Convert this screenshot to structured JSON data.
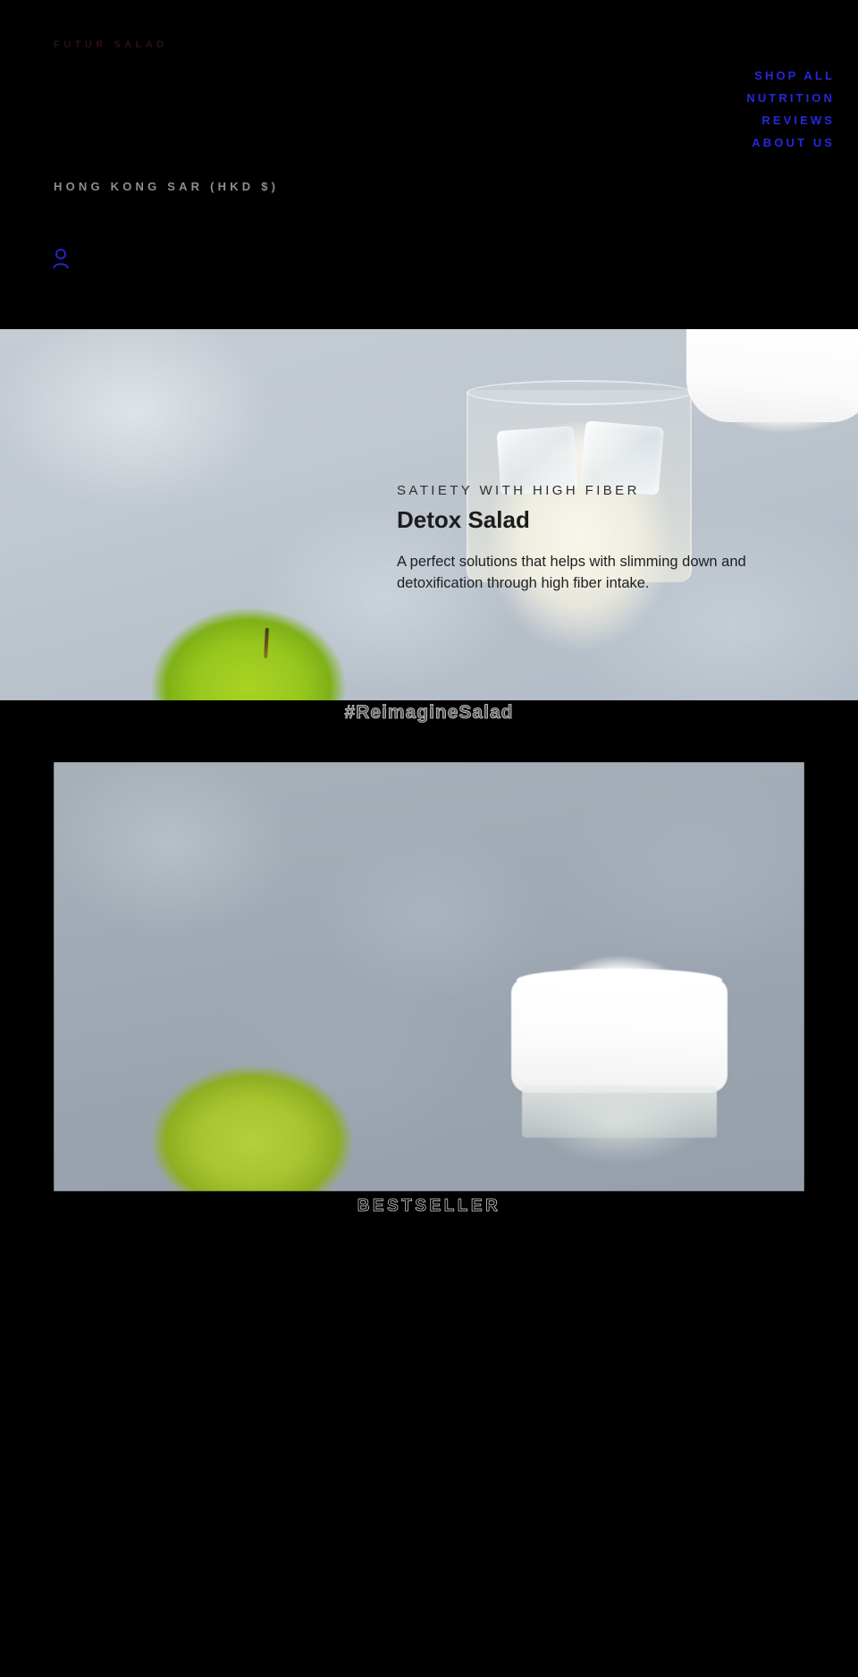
{
  "header": {
    "brand": "FUTUR SALAD",
    "nav": [
      {
        "label": "SHOP ALL"
      },
      {
        "label": "NUTRITION"
      },
      {
        "label": "REVIEWS"
      },
      {
        "label": "ABOUT US"
      }
    ],
    "locale_selector": "HONG KONG SAR (HKD $)",
    "account_icon": "user-account-icon",
    "link_color": "#2727dd",
    "brand_color": "#2b1210",
    "locale_color": "#8e8e8e",
    "background": "#000000"
  },
  "hero": {
    "eyebrow": "SATIETY WITH HIGH FIBER",
    "title": "Detox Salad",
    "description": "A perfect solutions that helps with slimming down and detoxification through high fiber intake.",
    "image_alt": "Green apple beside a glass of milk with ice cubes and a white jar lid on a blue-grey background",
    "text_color": "#1c1c1c"
  },
  "hashtag_banner": {
    "text": "#ReimagineSalad",
    "stroke_color": "#cfcfcf"
  },
  "product_card": {
    "image_alt": "Blurred green apple and a white-capped glass jar on a grey background",
    "badge": "BESTSELLER",
    "badge_stroke_color": "#c8c8c8"
  }
}
